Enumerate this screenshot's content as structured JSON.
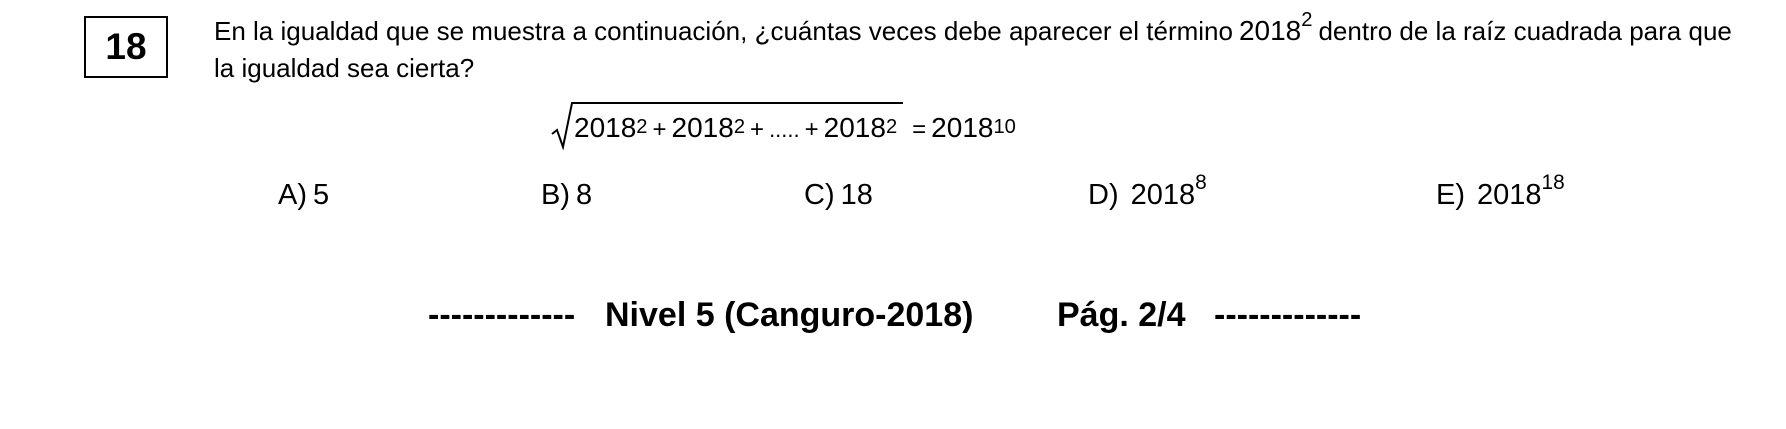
{
  "question": {
    "number": "18",
    "text_before": "En la igualdad que se muestra a continuación, ¿cuántas veces debe aparecer el término",
    "term_base": "2018",
    "term_exp": "2",
    "text_after": "dentro de la raíz cuadrada para que la igualdad sea cierta?"
  },
  "equation": {
    "term1_base": "2018",
    "term1_exp": "2",
    "plus1": "+",
    "term2_base": "2018",
    "term2_exp": "2",
    "plus2": "+",
    "dots": ".....",
    "plus3": "+",
    "term3_base": "2018",
    "term3_exp": "2",
    "equals": "=",
    "rhs_base": "2018",
    "rhs_exp": "10"
  },
  "options": [
    {
      "label": "A)",
      "value": "5",
      "exp": ""
    },
    {
      "label": "B)",
      "value": "8",
      "exp": ""
    },
    {
      "label": "C)",
      "value": "18",
      "exp": ""
    },
    {
      "label": "D)",
      "value": "2018",
      "exp": "8"
    },
    {
      "label": "E)",
      "value": "2018",
      "exp": "18"
    }
  ],
  "footer": {
    "dashes_left": "-------------",
    "level": "Nivel 5 (Canguro-2018)",
    "page": "Pág. 2/4",
    "dashes_right": "-------------"
  }
}
